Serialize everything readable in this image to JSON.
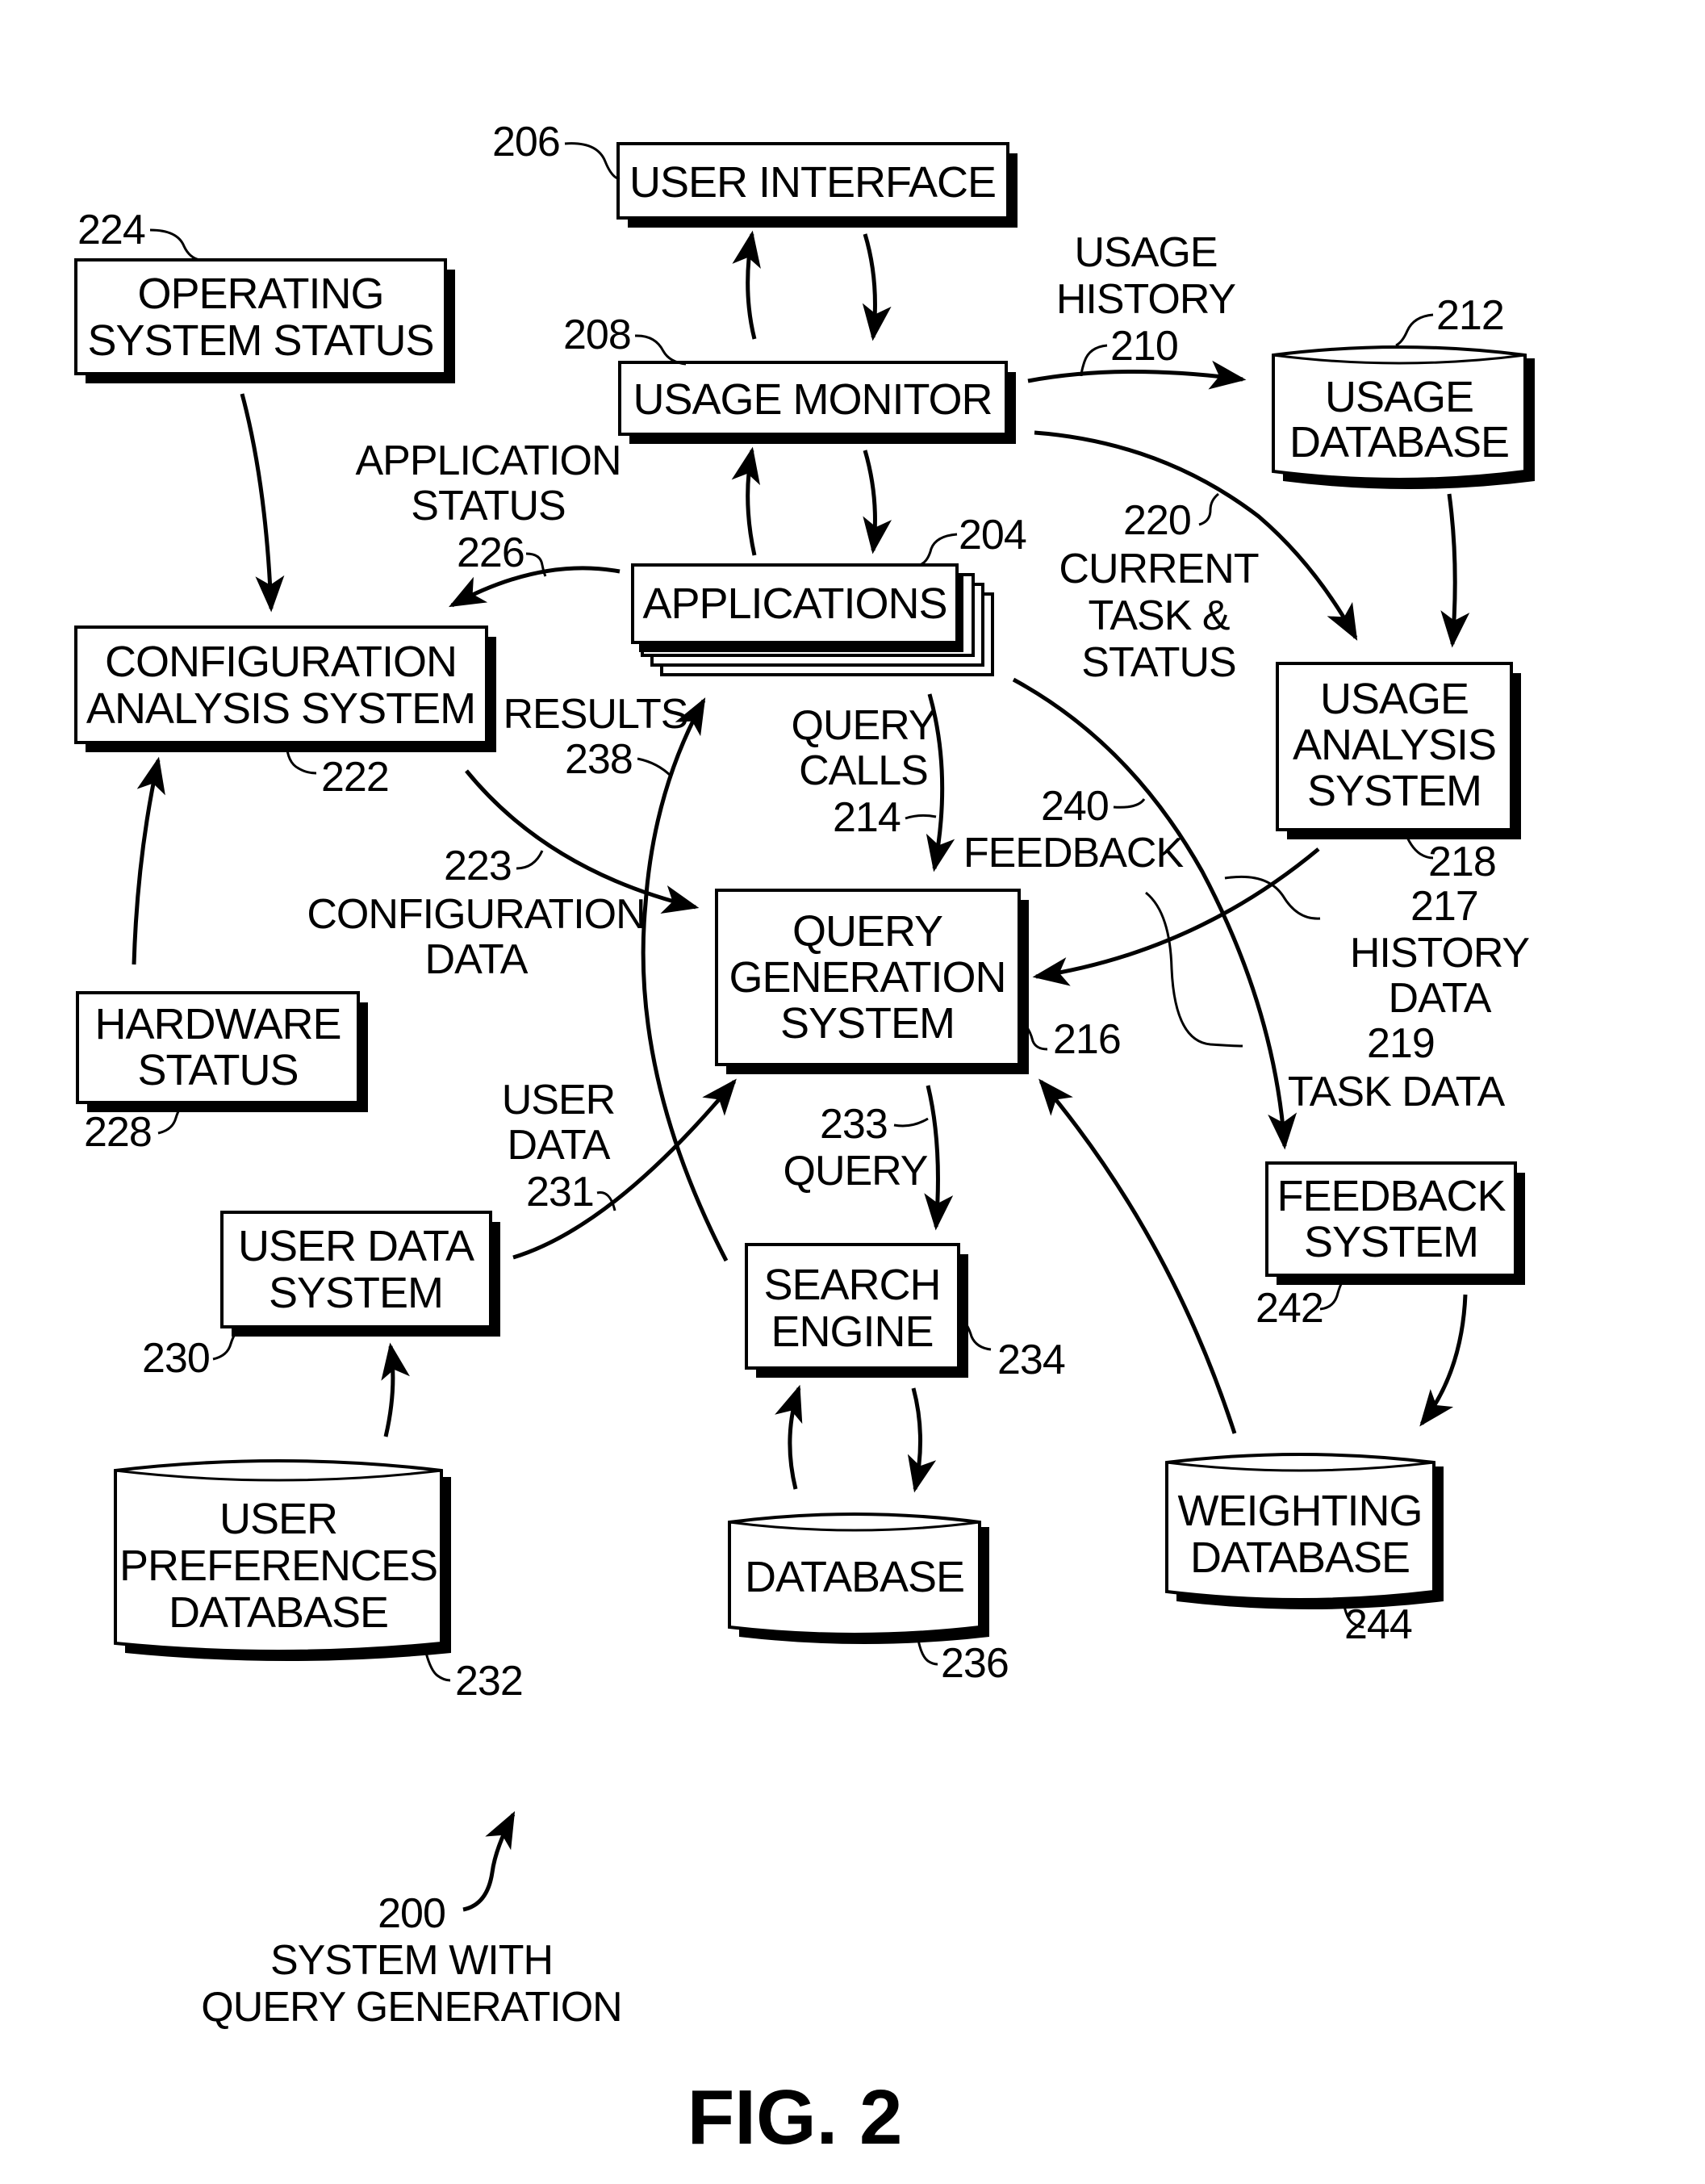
{
  "figure": {
    "title": "FIG. 2",
    "system_ref": "200",
    "system_caption": [
      "SYSTEM WITH",
      "QUERY GENERATION"
    ]
  },
  "nodes": {
    "user_interface": {
      "ref": "206",
      "lines": [
        "USER INTERFACE"
      ],
      "shape": "box"
    },
    "operating_system_status": {
      "ref": "224",
      "lines": [
        "OPERATING",
        "SYSTEM STATUS"
      ],
      "shape": "box"
    },
    "usage_monitor": {
      "ref": "208",
      "lines": [
        "USAGE MONITOR"
      ],
      "shape": "box"
    },
    "usage_database": {
      "ref": "212",
      "lines": [
        "USAGE",
        "DATABASE"
      ],
      "shape": "cylinder"
    },
    "applications": {
      "ref": "204",
      "lines": [
        "APPLICATIONS"
      ],
      "shape": "stacked-box"
    },
    "configuration_analysis_system": {
      "ref": "222",
      "lines": [
        "CONFIGURATION",
        "ANALYSIS SYSTEM"
      ],
      "shape": "box"
    },
    "usage_analysis_system": {
      "ref": "218",
      "lines": [
        "USAGE",
        "ANALYSIS",
        "SYSTEM"
      ],
      "shape": "box"
    },
    "query_generation_system": {
      "ref": "216",
      "lines": [
        "QUERY",
        "GENERATION",
        "SYSTEM"
      ],
      "shape": "box"
    },
    "hardware_status": {
      "ref": "228",
      "lines": [
        "HARDWARE",
        "STATUS"
      ],
      "shape": "box"
    },
    "feedback_system": {
      "ref": "242",
      "lines": [
        "FEEDBACK",
        "SYSTEM"
      ],
      "shape": "box"
    },
    "user_data_system": {
      "ref": "230",
      "lines": [
        "USER DATA",
        "SYSTEM"
      ],
      "shape": "box"
    },
    "search_engine": {
      "ref": "234",
      "lines": [
        "SEARCH",
        "ENGINE"
      ],
      "shape": "box"
    },
    "user_preferences_database": {
      "ref": "232",
      "lines": [
        "USER",
        "PREFERENCES",
        "DATABASE"
      ],
      "shape": "cylinder"
    },
    "database": {
      "ref": "236",
      "lines": [
        "DATABASE"
      ],
      "shape": "cylinder"
    },
    "weighting_database": {
      "ref": "244",
      "lines": [
        "WEIGHTING",
        "DATABASE"
      ],
      "shape": "cylinder"
    }
  },
  "edges": {
    "usage_history": {
      "ref": "210",
      "lines": [
        "USAGE",
        "HISTORY"
      ],
      "from": "usage_monitor",
      "to": "usage_database"
    },
    "current_task_status": {
      "ref": "220",
      "lines": [
        "CURRENT",
        "TASK &",
        "STATUS"
      ],
      "from": "usage_monitor",
      "to": "usage_analysis_system"
    },
    "application_status": {
      "ref": "226",
      "lines": [
        "APPLICATION",
        "STATUS"
      ],
      "from": "applications",
      "to": "configuration_analysis_system"
    },
    "query_calls": {
      "ref": "214",
      "lines": [
        "QUERY",
        "CALLS"
      ],
      "from": "applications",
      "to": "query_generation_system"
    },
    "results": {
      "ref": "238",
      "lines": [
        "RESULTS"
      ],
      "from": "search_engine",
      "to": "applications"
    },
    "configuration_data": {
      "ref": "223",
      "lines": [
        "CONFIGURATION",
        "DATA"
      ],
      "from": "configuration_analysis_system",
      "to": "query_generation_system"
    },
    "feedback": {
      "ref": "240",
      "lines": [
        "FEEDBACK"
      ],
      "from": "applications",
      "to": "feedback_system"
    },
    "history_data": {
      "ref": "217",
      "lines": [
        "HISTORY",
        "DATA"
      ],
      "from": "usage_analysis_system",
      "to": "query_generation_system"
    },
    "task_data": {
      "ref": "219",
      "lines": [
        "TASK DATA"
      ],
      "from": "usage_analysis_system",
      "to": "query_generation_system"
    },
    "user_data": {
      "ref": "231",
      "lines": [
        "USER",
        "DATA"
      ],
      "from": "user_data_system",
      "to": "query_generation_system"
    },
    "query": {
      "ref": "233",
      "lines": [
        "QUERY"
      ],
      "from": "query_generation_system",
      "to": "search_engine"
    },
    "ui_to_monitor": {
      "from": "user_interface",
      "to": "usage_monitor"
    },
    "monitor_to_ui": {
      "from": "usage_monitor",
      "to": "user_interface"
    },
    "monitor_to_apps": {
      "from": "usage_monitor",
      "to": "applications"
    },
    "apps_to_monitor": {
      "from": "applications",
      "to": "usage_monitor"
    },
    "os_status_to_config": {
      "from": "operating_system_status",
      "to": "configuration_analysis_system"
    },
    "hardware_to_config": {
      "from": "hardware_status",
      "to": "configuration_analysis_system"
    },
    "usage_db_to_analysis": {
      "from": "usage_database",
      "to": "usage_analysis_system"
    },
    "prefs_to_user_data": {
      "from": "user_preferences_database",
      "to": "user_data_system"
    },
    "search_to_db": {
      "from": "search_engine",
      "to": "database"
    },
    "db_to_search": {
      "from": "database",
      "to": "search_engine"
    },
    "feedback_to_weighting": {
      "from": "feedback_system",
      "to": "weighting_database"
    },
    "weighting_to_query": {
      "from": "weighting_database",
      "to": "query_generation_system"
    }
  }
}
